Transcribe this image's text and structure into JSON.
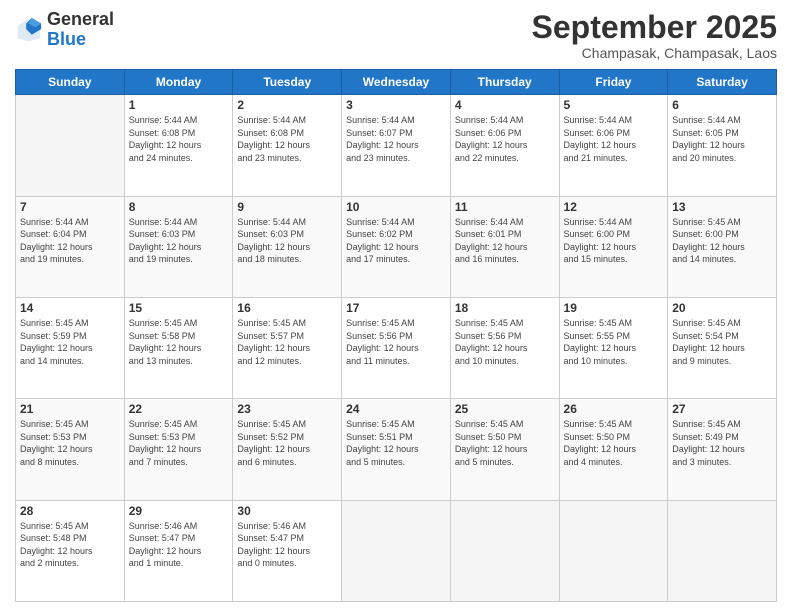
{
  "header": {
    "logo_line1": "General",
    "logo_line2": "Blue",
    "month": "September 2025",
    "location": "Champasak, Champasak, Laos"
  },
  "weekdays": [
    "Sunday",
    "Monday",
    "Tuesday",
    "Wednesday",
    "Thursday",
    "Friday",
    "Saturday"
  ],
  "weeks": [
    [
      {
        "num": "",
        "info": ""
      },
      {
        "num": "1",
        "info": "Sunrise: 5:44 AM\nSunset: 6:08 PM\nDaylight: 12 hours\nand 24 minutes."
      },
      {
        "num": "2",
        "info": "Sunrise: 5:44 AM\nSunset: 6:08 PM\nDaylight: 12 hours\nand 23 minutes."
      },
      {
        "num": "3",
        "info": "Sunrise: 5:44 AM\nSunset: 6:07 PM\nDaylight: 12 hours\nand 23 minutes."
      },
      {
        "num": "4",
        "info": "Sunrise: 5:44 AM\nSunset: 6:06 PM\nDaylight: 12 hours\nand 22 minutes."
      },
      {
        "num": "5",
        "info": "Sunrise: 5:44 AM\nSunset: 6:06 PM\nDaylight: 12 hours\nand 21 minutes."
      },
      {
        "num": "6",
        "info": "Sunrise: 5:44 AM\nSunset: 6:05 PM\nDaylight: 12 hours\nand 20 minutes."
      }
    ],
    [
      {
        "num": "7",
        "info": "Sunrise: 5:44 AM\nSunset: 6:04 PM\nDaylight: 12 hours\nand 19 minutes."
      },
      {
        "num": "8",
        "info": "Sunrise: 5:44 AM\nSunset: 6:03 PM\nDaylight: 12 hours\nand 19 minutes."
      },
      {
        "num": "9",
        "info": "Sunrise: 5:44 AM\nSunset: 6:03 PM\nDaylight: 12 hours\nand 18 minutes."
      },
      {
        "num": "10",
        "info": "Sunrise: 5:44 AM\nSunset: 6:02 PM\nDaylight: 12 hours\nand 17 minutes."
      },
      {
        "num": "11",
        "info": "Sunrise: 5:44 AM\nSunset: 6:01 PM\nDaylight: 12 hours\nand 16 minutes."
      },
      {
        "num": "12",
        "info": "Sunrise: 5:44 AM\nSunset: 6:00 PM\nDaylight: 12 hours\nand 15 minutes."
      },
      {
        "num": "13",
        "info": "Sunrise: 5:45 AM\nSunset: 6:00 PM\nDaylight: 12 hours\nand 14 minutes."
      }
    ],
    [
      {
        "num": "14",
        "info": "Sunrise: 5:45 AM\nSunset: 5:59 PM\nDaylight: 12 hours\nand 14 minutes."
      },
      {
        "num": "15",
        "info": "Sunrise: 5:45 AM\nSunset: 5:58 PM\nDaylight: 12 hours\nand 13 minutes."
      },
      {
        "num": "16",
        "info": "Sunrise: 5:45 AM\nSunset: 5:57 PM\nDaylight: 12 hours\nand 12 minutes."
      },
      {
        "num": "17",
        "info": "Sunrise: 5:45 AM\nSunset: 5:56 PM\nDaylight: 12 hours\nand 11 minutes."
      },
      {
        "num": "18",
        "info": "Sunrise: 5:45 AM\nSunset: 5:56 PM\nDaylight: 12 hours\nand 10 minutes."
      },
      {
        "num": "19",
        "info": "Sunrise: 5:45 AM\nSunset: 5:55 PM\nDaylight: 12 hours\nand 10 minutes."
      },
      {
        "num": "20",
        "info": "Sunrise: 5:45 AM\nSunset: 5:54 PM\nDaylight: 12 hours\nand 9 minutes."
      }
    ],
    [
      {
        "num": "21",
        "info": "Sunrise: 5:45 AM\nSunset: 5:53 PM\nDaylight: 12 hours\nand 8 minutes."
      },
      {
        "num": "22",
        "info": "Sunrise: 5:45 AM\nSunset: 5:53 PM\nDaylight: 12 hours\nand 7 minutes."
      },
      {
        "num": "23",
        "info": "Sunrise: 5:45 AM\nSunset: 5:52 PM\nDaylight: 12 hours\nand 6 minutes."
      },
      {
        "num": "24",
        "info": "Sunrise: 5:45 AM\nSunset: 5:51 PM\nDaylight: 12 hours\nand 5 minutes."
      },
      {
        "num": "25",
        "info": "Sunrise: 5:45 AM\nSunset: 5:50 PM\nDaylight: 12 hours\nand 5 minutes."
      },
      {
        "num": "26",
        "info": "Sunrise: 5:45 AM\nSunset: 5:50 PM\nDaylight: 12 hours\nand 4 minutes."
      },
      {
        "num": "27",
        "info": "Sunrise: 5:45 AM\nSunset: 5:49 PM\nDaylight: 12 hours\nand 3 minutes."
      }
    ],
    [
      {
        "num": "28",
        "info": "Sunrise: 5:45 AM\nSunset: 5:48 PM\nDaylight: 12 hours\nand 2 minutes."
      },
      {
        "num": "29",
        "info": "Sunrise: 5:46 AM\nSunset: 5:47 PM\nDaylight: 12 hours\nand 1 minute."
      },
      {
        "num": "30",
        "info": "Sunrise: 5:46 AM\nSunset: 5:47 PM\nDaylight: 12 hours\nand 0 minutes."
      },
      {
        "num": "",
        "info": ""
      },
      {
        "num": "",
        "info": ""
      },
      {
        "num": "",
        "info": ""
      },
      {
        "num": "",
        "info": ""
      }
    ]
  ]
}
